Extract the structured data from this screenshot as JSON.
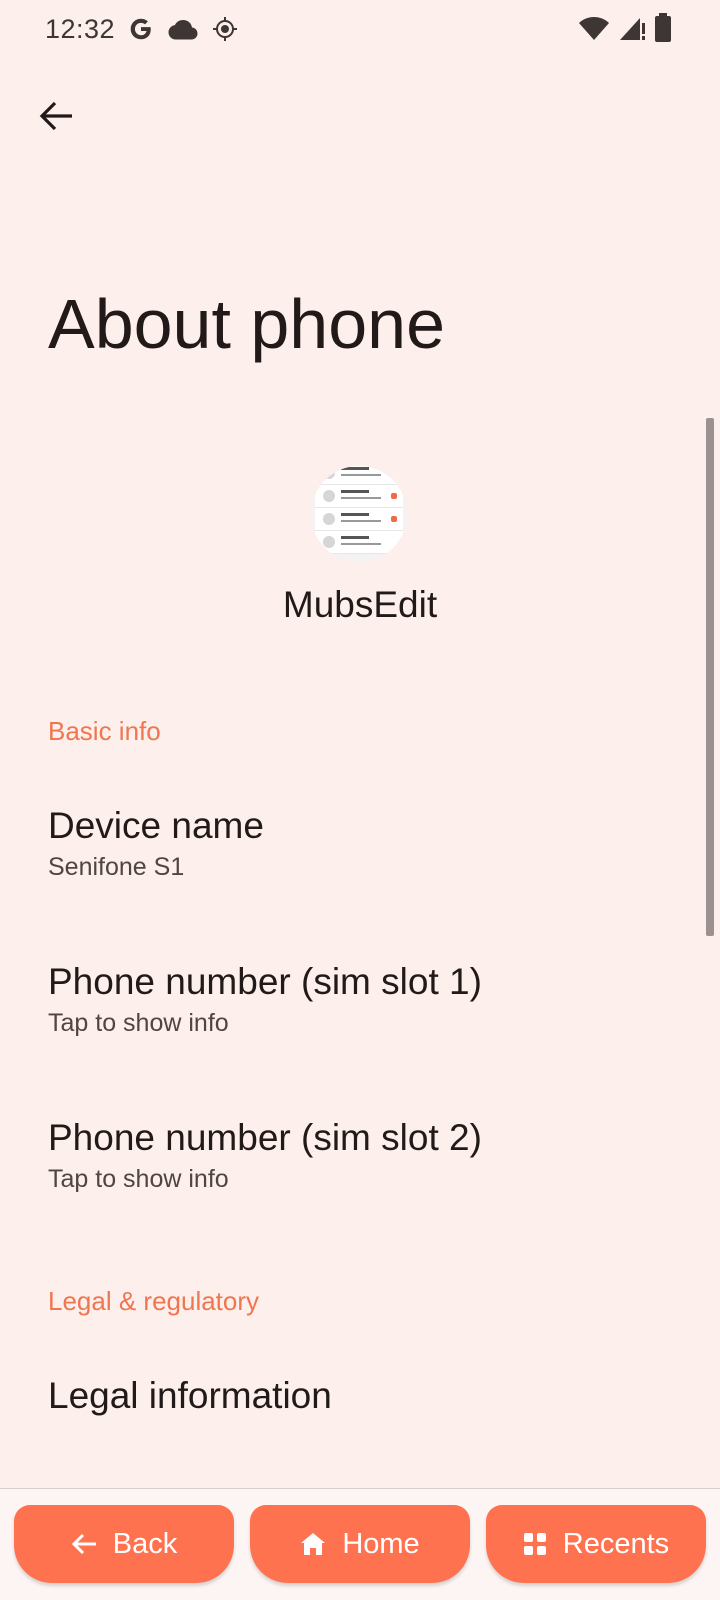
{
  "status_bar": {
    "time": "12:32",
    "left_icons": [
      "google-icon",
      "cloud-icon",
      "location-icon"
    ],
    "right_icons": [
      "wifi-icon",
      "signal-icon",
      "battery-icon"
    ]
  },
  "app_bar": {
    "back_icon": "arrow-back-icon"
  },
  "page": {
    "title": "About phone"
  },
  "app_header": {
    "name": "MubsEdit"
  },
  "sections": {
    "basic_info": {
      "header": "Basic info",
      "items": [
        {
          "title": "Device name",
          "summary": "Senifone S1"
        },
        {
          "title": "Phone number (sim slot 1)",
          "summary": "Tap to show info"
        },
        {
          "title": "Phone number (sim slot 2)",
          "summary": "Tap to show info"
        }
      ]
    },
    "legal": {
      "header": "Legal & regulatory",
      "items": [
        {
          "title": "Legal information"
        }
      ]
    }
  },
  "nav": {
    "back_label": "Back",
    "home_label": "Home",
    "recents_label": "Recents"
  },
  "colors": {
    "background": "#fcefec",
    "accent": "#f0764f",
    "nav_button": "#ff7250"
  }
}
